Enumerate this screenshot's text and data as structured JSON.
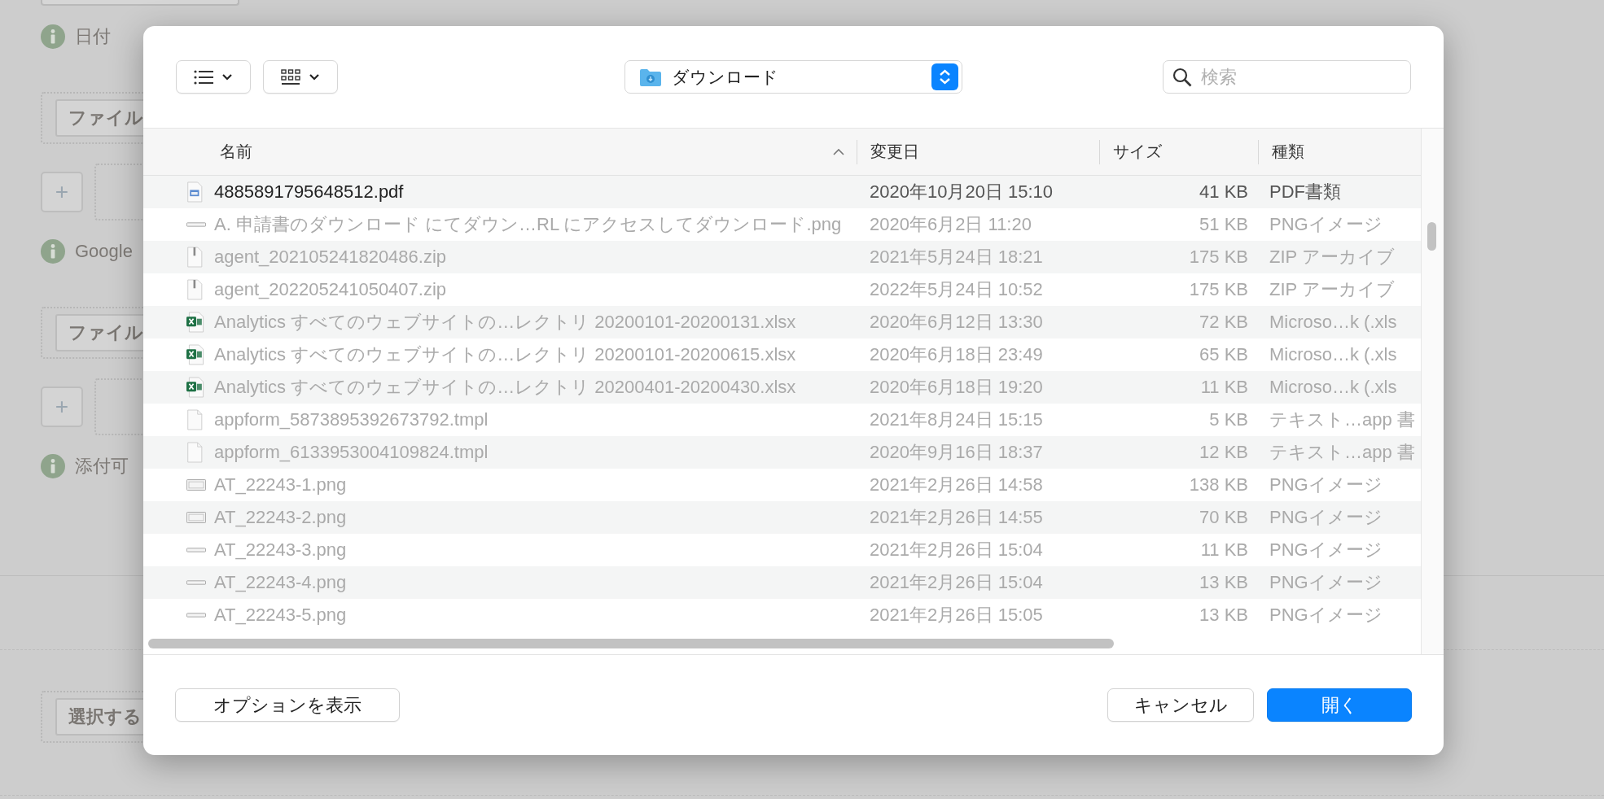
{
  "background": {
    "items": [
      {
        "kind": "field"
      },
      {
        "kind": "info",
        "label": "日付"
      },
      {
        "kind": "file",
        "button": "ファイル"
      },
      {
        "kind": "add",
        "button": "+"
      },
      {
        "kind": "info",
        "label": "Google"
      },
      {
        "kind": "file",
        "button": "ファイル"
      },
      {
        "kind": "add",
        "button": "+"
      },
      {
        "kind": "info",
        "label": "添付可"
      },
      {
        "kind": "rule"
      },
      {
        "kind": "file",
        "button": "選択する"
      }
    ]
  },
  "dialog": {
    "location": "ダウンロード",
    "search": {
      "placeholder": "検索"
    },
    "columns": [
      {
        "label": "名前",
        "sorted": true
      },
      {
        "label": "変更日",
        "sorted": false
      },
      {
        "label": "サイズ",
        "sorted": false
      },
      {
        "label": "種類",
        "sorted": false
      }
    ],
    "rows": [
      {
        "kind": "pdf",
        "name": "4885891795648512.pdf",
        "date": "2020年10月20日 15:10",
        "size": "41 KB",
        "type": "PDF書類",
        "disabled": false
      },
      {
        "kind": "png-strip",
        "name": "A. 申請書のダウンロード にてダウン…RL にアクセスしてダウンロード.png",
        "date": "2020年6月2日 11:20",
        "size": "51 KB",
        "type": "PNGイメージ",
        "disabled": true
      },
      {
        "kind": "zip",
        "name": "agent_202105241820486.zip",
        "date": "2021年5月24日 18:21",
        "size": "175 KB",
        "type": "ZIP アーカイブ",
        "disabled": true
      },
      {
        "kind": "zip",
        "name": "agent_202205241050407.zip",
        "date": "2022年5月24日 10:52",
        "size": "175 KB",
        "type": "ZIP アーカイブ",
        "disabled": true
      },
      {
        "kind": "xlsx",
        "name": "Analytics すべてのウェブサイトの…レクトリ 20200101-20200131.xlsx",
        "date": "2020年6月12日 13:30",
        "size": "72 KB",
        "type": "Microso…k (.xls",
        "disabled": true
      },
      {
        "kind": "xlsx",
        "name": "Analytics すべてのウェブサイトの…レクトリ 20200101-20200615.xlsx",
        "date": "2020年6月18日 23:49",
        "size": "65 KB",
        "type": "Microso…k (.xls",
        "disabled": true
      },
      {
        "kind": "xlsx",
        "name": "Analytics すべてのウェブサイトの…レクトリ 20200401-20200430.xlsx",
        "date": "2020年6月18日 19:20",
        "size": "11 KB",
        "type": "Microso…k (.xls",
        "disabled": true
      },
      {
        "kind": "doc",
        "name": "appform_5873895392673792.tmpl",
        "date": "2021年8月24日 15:15",
        "size": "5 KB",
        "type": "テキスト…app 書",
        "disabled": true
      },
      {
        "kind": "doc",
        "name": "appform_6133953004109824.tmpl",
        "date": "2020年9月16日 18:37",
        "size": "12 KB",
        "type": "テキスト…app 書",
        "disabled": true
      },
      {
        "kind": "png-frame",
        "name": "AT_22243-1.png",
        "date": "2021年2月26日 14:58",
        "size": "138 KB",
        "type": "PNGイメージ",
        "disabled": true
      },
      {
        "kind": "png-frame",
        "name": "AT_22243-2.png",
        "date": "2021年2月26日 14:55",
        "size": "70 KB",
        "type": "PNGイメージ",
        "disabled": true
      },
      {
        "kind": "png-strip",
        "name": "AT_22243-3.png",
        "date": "2021年2月26日 15:04",
        "size": "11 KB",
        "type": "PNGイメージ",
        "disabled": true
      },
      {
        "kind": "png-strip",
        "name": "AT_22243-4.png",
        "date": "2021年2月26日 15:04",
        "size": "13 KB",
        "type": "PNGイメージ",
        "disabled": true
      },
      {
        "kind": "png-strip",
        "name": "AT_22243-5.png",
        "date": "2021年2月26日 15:05",
        "size": "13 KB",
        "type": "PNGイメージ",
        "disabled": true
      }
    ],
    "buttons": [
      {
        "label": "オプションを表示",
        "kind": "plain"
      },
      {
        "label": "キャンセル",
        "kind": "plain"
      },
      {
        "label": "開く",
        "kind": "default"
      }
    ]
  }
}
